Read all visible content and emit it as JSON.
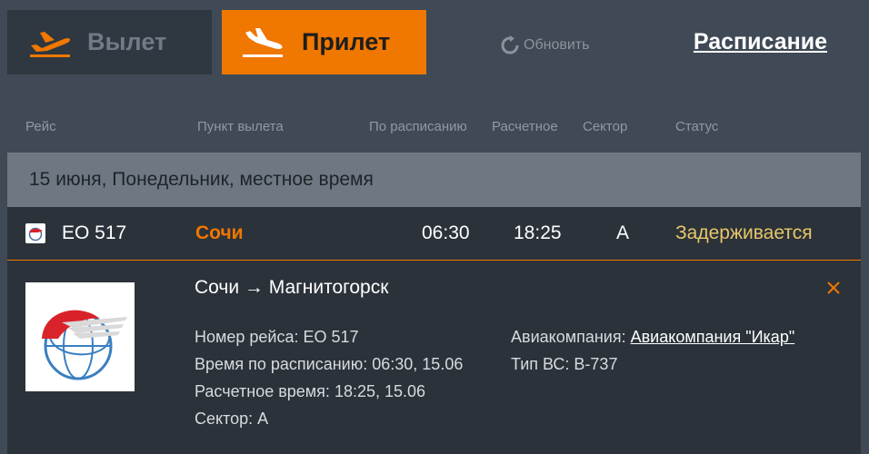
{
  "tabs": {
    "departures": "Вылет",
    "arrivals": "Прилет"
  },
  "refresh_label": "Обновить",
  "schedule_link": "Расписание",
  "columns": {
    "flight": "Рейс",
    "origin": "Пункт вылета",
    "scheduled": "По расписанию",
    "estimated": "Расчетное",
    "sector": "Сектор",
    "status": "Статус"
  },
  "date_header": "15 июня, Понедельник, местное время",
  "flight": {
    "number": "EO 517",
    "city": "Сочи",
    "scheduled": "06:30",
    "estimated": "18:25",
    "sector": "A",
    "status": "Задерживается"
  },
  "details": {
    "route": "Сочи → Магнитогорск",
    "flight_number_label": "Номер рейса: ",
    "flight_number": "EO 517",
    "scheduled_label": "Время по расписанию: ",
    "scheduled": "06:30, 15.06",
    "estimated_label": "Расчетное время: ",
    "estimated": "18:25, 15.06",
    "sector_label": "Сектор: ",
    "sector": "A",
    "airline_label": "Авиакомпания: ",
    "airline": "Авиакомпания \"Икар\"",
    "aircraft_label": "Тип ВС: ",
    "aircraft": "B-737"
  },
  "colors": {
    "accent": "#f07700",
    "background": "#3f4a56",
    "row": "#2b323a",
    "status_delayed": "#e8c66a"
  }
}
